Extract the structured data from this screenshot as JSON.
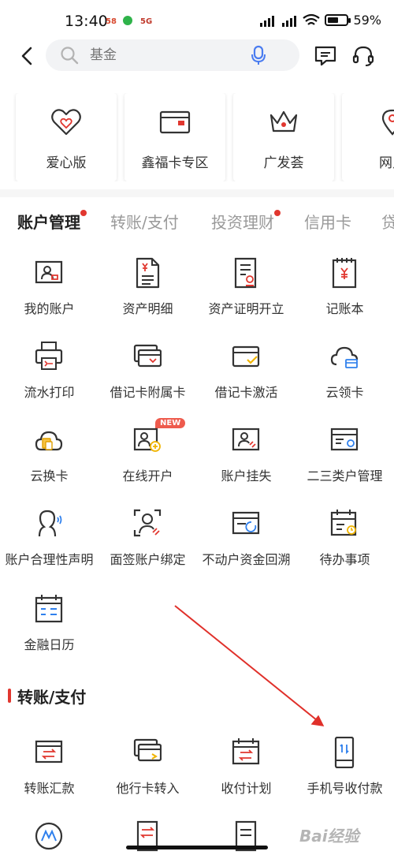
{
  "status": {
    "time": "13:40",
    "indicators": [
      "58",
      "5G"
    ],
    "battery": "59%",
    "battery_level": 0.59
  },
  "search": {
    "placeholder": "基金",
    "icons": [
      "back-arrow-icon",
      "search-icon",
      "microphone-icon",
      "message-icon",
      "customer-service-icon"
    ]
  },
  "quick_links": [
    {
      "label": "爱心版",
      "icon": "heart-icon"
    },
    {
      "label": "鑫福卡专区",
      "icon": "bank-card-icon"
    },
    {
      "label": "广发荟",
      "icon": "crown-icon"
    },
    {
      "label": "网点",
      "icon": "location-icon"
    }
  ],
  "tabs": [
    {
      "label": "账户管理",
      "active": true,
      "dot": true
    },
    {
      "label": "转账/支付",
      "active": false,
      "dot": false
    },
    {
      "label": "投资理财",
      "active": false,
      "dot": true
    },
    {
      "label": "信用卡",
      "active": false,
      "dot": false
    },
    {
      "label": "贷",
      "active": false,
      "dot": false
    }
  ],
  "account_items": [
    {
      "label": "我的账户",
      "icon": "my-account-icon"
    },
    {
      "label": "资产明细",
      "icon": "asset-detail-icon"
    },
    {
      "label": "资产证明开立",
      "icon": "asset-certificate-icon"
    },
    {
      "label": "记账本",
      "icon": "ledger-icon"
    },
    {
      "label": "流水打印",
      "icon": "printer-icon"
    },
    {
      "label": "借记卡附属卡",
      "icon": "debit-sub-card-icon"
    },
    {
      "label": "借记卡激活",
      "icon": "card-activate-icon"
    },
    {
      "label": "云领卡",
      "icon": "cloud-card-icon"
    },
    {
      "label": "云换卡",
      "icon": "cloud-swap-card-icon"
    },
    {
      "label": "在线开户",
      "icon": "open-account-icon",
      "badge": "NEW"
    },
    {
      "label": "账户挂失",
      "icon": "account-loss-icon"
    },
    {
      "label": "二三类户管理",
      "icon": "account-class-icon"
    },
    {
      "label": "账户合理性声明",
      "icon": "account-statement-icon"
    },
    {
      "label": "面签账户绑定",
      "icon": "face-sign-icon"
    },
    {
      "label": "不动户资金回溯",
      "icon": "dormant-account-icon"
    },
    {
      "label": "待办事项",
      "icon": "todo-icon"
    },
    {
      "label": "金融日历",
      "icon": "finance-calendar-icon"
    }
  ],
  "transfer_section": {
    "title": "转账/支付",
    "items": [
      {
        "label": "转账汇款",
        "icon": "transfer-icon"
      },
      {
        "label": "他行卡转入",
        "icon": "other-bank-card-icon"
      },
      {
        "label": "收付计划",
        "icon": "payment-plan-icon"
      },
      {
        "label": "手机号收付款",
        "icon": "phone-payment-icon"
      }
    ]
  },
  "watermark": "Bai经验",
  "colors": {
    "accent": "#e1372f",
    "icon_stroke": "#333333",
    "tab_inactive": "#999999",
    "annotation_arrow": "#e0302a"
  }
}
